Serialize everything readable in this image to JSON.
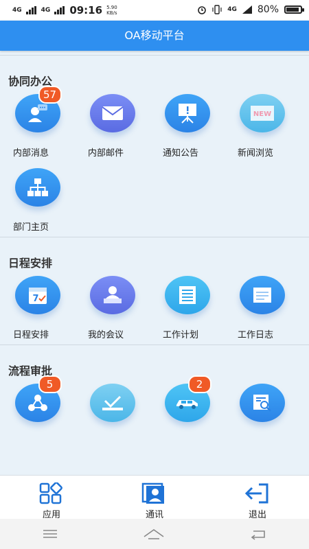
{
  "status_bar": {
    "signal1": "4G",
    "signal2": "4G",
    "time": "09:16",
    "speed_value": "5.90",
    "speed_unit": "KB/s",
    "net": "4G",
    "battery": "80%",
    "battery_level": 0.8
  },
  "header": {
    "title": "OA移动平台"
  },
  "sections": [
    {
      "title": "协同办公",
      "items": [
        {
          "label": "内部消息",
          "icon": "chat-person-icon",
          "badge": "57"
        },
        {
          "label": "内部邮件",
          "icon": "mail-icon"
        },
        {
          "label": "通知公告",
          "icon": "notice-board-icon"
        },
        {
          "label": "新闻浏览",
          "icon": "news-icon",
          "icon_text": "NEW"
        },
        {
          "label": "部门主页",
          "icon": "org-chart-icon"
        }
      ]
    },
    {
      "title": "日程安排",
      "items": [
        {
          "label": "日程安排",
          "icon": "calendar-icon",
          "icon_text": "7"
        },
        {
          "label": "我的会议",
          "icon": "meeting-icon"
        },
        {
          "label": "工作计划",
          "icon": "list-icon"
        },
        {
          "label": "工作日志",
          "icon": "log-icon"
        }
      ]
    },
    {
      "title": "流程审批",
      "items": [
        {
          "label": "",
          "icon": "workflow-icon",
          "badge": "5"
        },
        {
          "label": "",
          "icon": "approve-check-icon"
        },
        {
          "label": "",
          "icon": "car-icon",
          "badge": "2"
        },
        {
          "label": "",
          "icon": "search-doc-icon"
        }
      ]
    }
  ],
  "bottom_nav": [
    {
      "label": "应用",
      "icon": "apps-icon"
    },
    {
      "label": "通讯",
      "icon": "contacts-icon"
    },
    {
      "label": "退出",
      "icon": "logout-icon"
    }
  ],
  "system_nav": {
    "menu_icon": "menu-icon",
    "home_icon": "home-icon",
    "back_icon": "back-icon"
  },
  "colors": {
    "accent": "#2e8ff0",
    "badge": "#f05a26",
    "background": "#e9f2f9"
  }
}
